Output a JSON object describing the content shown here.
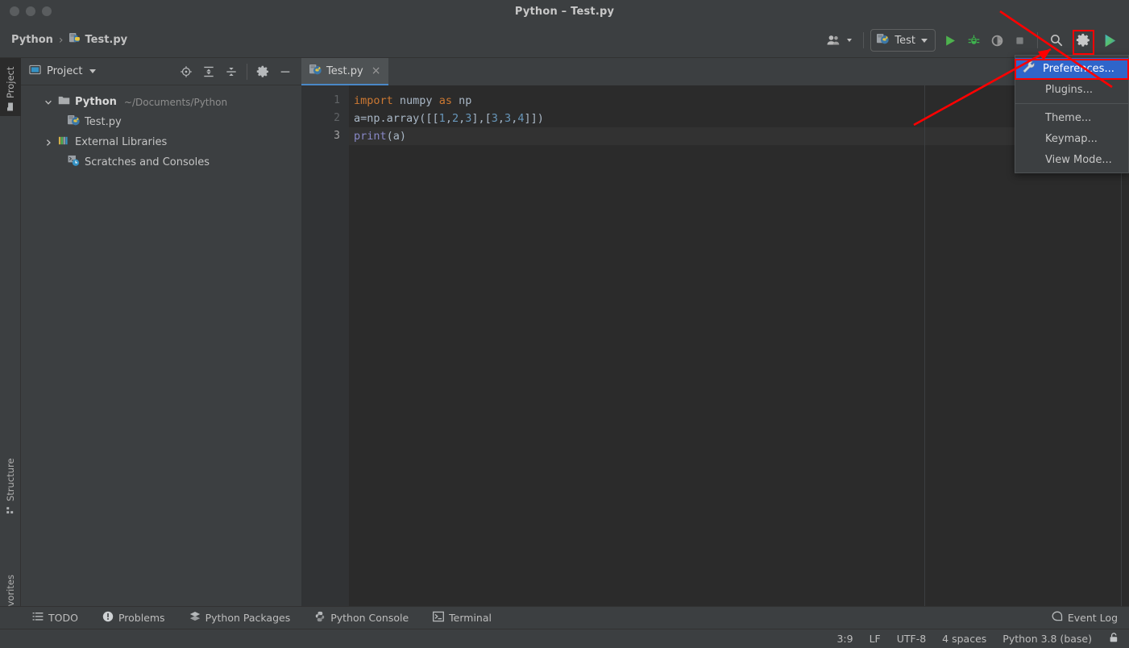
{
  "window": {
    "title": "Python – Test.py",
    "traffic_lights": [
      "close",
      "minimize",
      "maximize"
    ]
  },
  "breadcrumb": {
    "project": "Python",
    "separator": "›",
    "file": "Test.py"
  },
  "toolbar": {
    "user_icon": "people-icon",
    "run_config": {
      "label": "Test",
      "icon": "python-file-icon"
    },
    "buttons": [
      {
        "name": "run-button",
        "icon": "play-icon",
        "color": "#4eb24e"
      },
      {
        "name": "debug-button",
        "icon": "bug-icon",
        "color": "#3fb34f"
      },
      {
        "name": "coverage-button",
        "icon": "coverage-icon",
        "color": "#9a9a9a"
      },
      {
        "name": "stop-button",
        "icon": "stop-icon",
        "color": "#8a8a8a"
      },
      {
        "name": "search-button",
        "icon": "magnifier-icon",
        "color": "#c0c0c0"
      },
      {
        "name": "settings-button",
        "icon": "gear-icon",
        "color": "#c8c8c8"
      },
      {
        "name": "updates-button",
        "icon": "colored-play-icon",
        "color": "#3fb7c4"
      }
    ]
  },
  "settings_menu": {
    "items": [
      {
        "label": "Preferences...",
        "icon": "wrench-icon",
        "selected": true
      },
      {
        "label": "Plugins...",
        "icon": null,
        "selected": false
      },
      {
        "label": "Theme...",
        "icon": null,
        "selected": false
      },
      {
        "label": "Keymap...",
        "icon": null,
        "selected": false
      },
      {
        "label": "View Mode...",
        "icon": null,
        "selected": false
      }
    ]
  },
  "left_strip": {
    "items": [
      {
        "label": "Project",
        "icon": "folder-icon",
        "active": true
      },
      {
        "label": "Structure",
        "icon": "structure-icon",
        "active": false
      },
      {
        "label": "Favorites",
        "icon": "star-icon",
        "active": false
      }
    ],
    "bottom_icon": "windows-icon"
  },
  "project_panel": {
    "title": "Project",
    "title_icon": "project-icon",
    "tools": [
      {
        "name": "locate-icon"
      },
      {
        "name": "expand-all-icon"
      },
      {
        "name": "collapse-all-icon"
      },
      {
        "name": "panel-settings-gear-icon"
      },
      {
        "name": "hide-panel-icon"
      }
    ],
    "tree": [
      {
        "name": "Python",
        "path": "~/Documents/Python",
        "icon": "folder-icon",
        "arrow": "expanded",
        "bold": true,
        "indent": 0
      },
      {
        "name": "Test.py",
        "path": "",
        "icon": "python-file-icon",
        "arrow": "none",
        "bold": false,
        "indent": 1
      },
      {
        "name": "External Libraries",
        "path": "",
        "icon": "libraries-icon",
        "arrow": "collapsed",
        "bold": false,
        "indent": 0
      },
      {
        "name": "Scratches and Consoles",
        "path": "",
        "icon": "scratches-icon",
        "arrow": "none",
        "bold": false,
        "indent": 0
      }
    ]
  },
  "editor": {
    "tab": {
      "label": "Test.py",
      "icon": "python-file-icon",
      "close": "×"
    },
    "line_numbers": [
      "1",
      "2",
      "3"
    ],
    "current_line": 3,
    "code_lines": [
      [
        {
          "t": "import",
          "c": "kw"
        },
        {
          "t": " numpy ",
          "c": ""
        },
        {
          "t": "as",
          "c": "kw"
        },
        {
          "t": " np",
          "c": ""
        }
      ],
      [
        {
          "t": "a=np.array([[",
          "c": ""
        },
        {
          "t": "1",
          "c": "num"
        },
        {
          "t": ",",
          "c": ""
        },
        {
          "t": "2",
          "c": "num"
        },
        {
          "t": ",",
          "c": ""
        },
        {
          "t": "3",
          "c": "num"
        },
        {
          "t": "],[",
          "c": ""
        },
        {
          "t": "3",
          "c": "num"
        },
        {
          "t": ",",
          "c": ""
        },
        {
          "t": "3",
          "c": "num"
        },
        {
          "t": ",",
          "c": ""
        },
        {
          "t": "4",
          "c": "num"
        },
        {
          "t": "]])",
          "c": ""
        }
      ],
      [
        {
          "t": "print",
          "c": "fn"
        },
        {
          "t": "(a)",
          "c": ""
        }
      ]
    ]
  },
  "bottom_tools": [
    {
      "label": "TODO",
      "icon": "list-icon"
    },
    {
      "label": "Problems",
      "icon": "warning-icon"
    },
    {
      "label": "Python Packages",
      "icon": "packages-icon"
    },
    {
      "label": "Python Console",
      "icon": "python-icon"
    },
    {
      "label": "Terminal",
      "icon": "terminal-icon"
    }
  ],
  "event_log": {
    "label": "Event Log",
    "icon": "balloon-icon"
  },
  "status_bar": {
    "position": "3:9",
    "line_separator": "LF",
    "encoding": "UTF-8",
    "indent": "4 spaces",
    "interpreter": "Python 3.8 (base)",
    "lock_icon": "lock-icon"
  },
  "colors": {
    "panel_bg": "#3c3f41",
    "editor_bg": "#2b2b2b",
    "gutter_bg": "#313335",
    "selection_blue": "#2f65ca",
    "tab_underline": "#4a88c7",
    "annotation_red": "#ff0000",
    "keyword_orange": "#cc7832",
    "number_blue": "#6897bb",
    "function_purple": "#8888c6"
  }
}
